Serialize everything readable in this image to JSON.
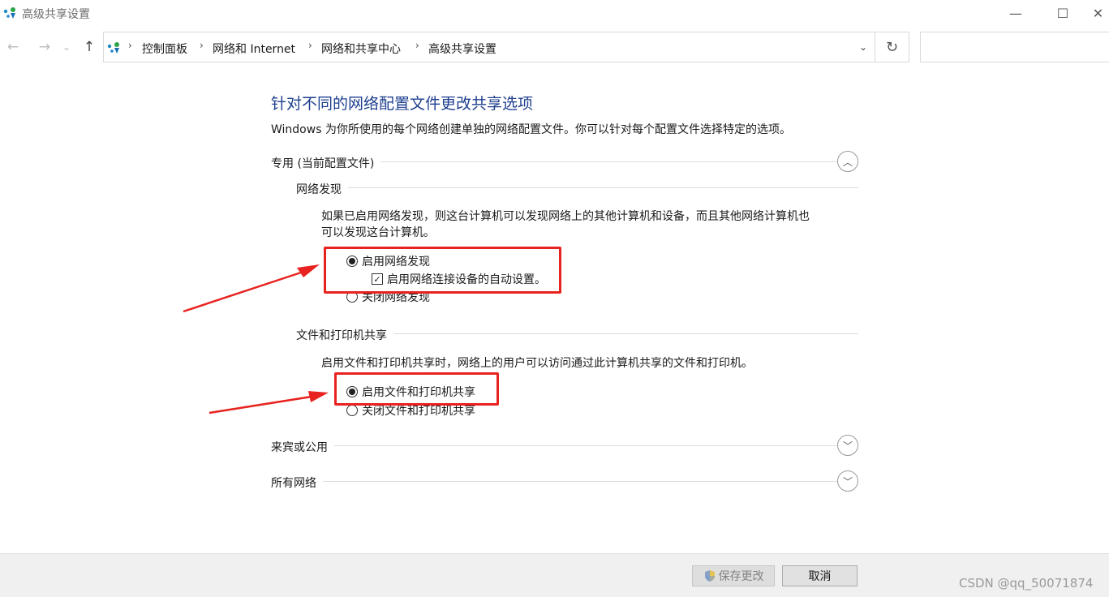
{
  "window": {
    "title": "高级共享设置",
    "minimize_glyph": "—",
    "maximize_glyph": "☐",
    "close_glyph": "✕"
  },
  "nav": {
    "back_glyph": "←",
    "forward_glyph": "→",
    "recent_glyph": "⌄",
    "up_glyph": "↑",
    "refresh_glyph": "↻",
    "dropdown_glyph": "⌄",
    "breadcrumbs": [
      "控制面板",
      "网络和 Internet",
      "网络和共享中心",
      "高级共享设置"
    ],
    "separator": "›"
  },
  "main": {
    "title": "针对不同的网络配置文件更改共享选项",
    "description": "Windows 为你所使用的每个网络创建单独的网络配置文件。你可以针对每个配置文件选择特定的选项。",
    "profiles": {
      "private": {
        "label": "专用 (当前配置文件)",
        "expanded": true,
        "chevron": "︿"
      },
      "guest": {
        "label": "来宾或公用",
        "expanded": false,
        "chevron": "﹀"
      },
      "all": {
        "label": "所有网络",
        "expanded": false,
        "chevron": "﹀"
      }
    },
    "network_discovery": {
      "heading": "网络发现",
      "desc_line1": "如果已启用网络发现，则这台计算机可以发现网络上的其他计算机和设备，而且其他网络计算机也",
      "desc_line2": "可以发现这台计算机。",
      "on_label": "启用网络发现",
      "auto_setup_label": "启用网络连接设备的自动设置。",
      "off_label": "关闭网络发现",
      "selected": "on",
      "auto_setup_checked": true,
      "check_glyph": "✓"
    },
    "file_printer_sharing": {
      "heading": "文件和打印机共享",
      "desc": "启用文件和打印机共享时，网络上的用户可以访问通过此计算机共享的文件和打印机。",
      "on_label": "启用文件和打印机共享",
      "off_label": "关闭文件和打印机共享",
      "selected": "on"
    }
  },
  "footer": {
    "save_label": "保存更改",
    "cancel_label": "取消",
    "watermark": "CSDN @qq_50071874"
  },
  "colors": {
    "title_blue": "#1e3f8f",
    "annotation_red": "#e8231f"
  }
}
